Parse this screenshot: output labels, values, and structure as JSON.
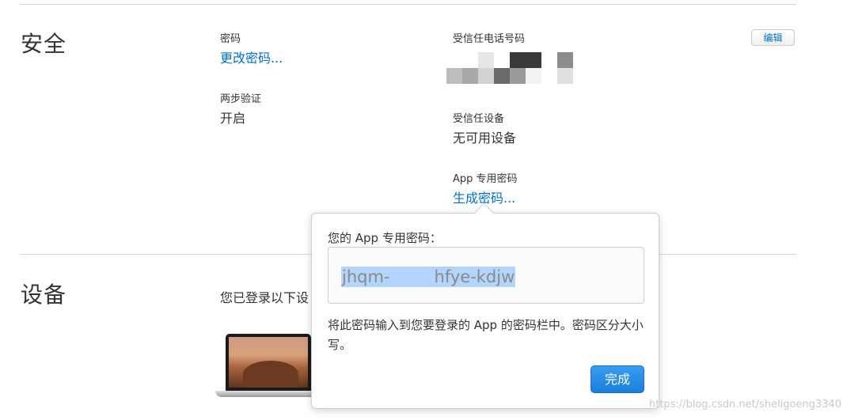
{
  "security": {
    "title": "安全",
    "password_label": "密码",
    "change_password_link": "更改密码...",
    "two_step_label": "两步验证",
    "two_step_value": "开启",
    "trusted_phone_label": "受信任电话号码",
    "trusted_device_label": "受信任设备",
    "trusted_device_value": "无可用设备",
    "app_password_label": "App 专用密码",
    "generate_link": "生成密码...",
    "edit_button": "编辑"
  },
  "popover": {
    "title": "您的 App 专用密码：",
    "password_part1": "jhqm-",
    "password_part2": "hfye-kdjw",
    "description": "将此密码输入到您要登录的 App 的密码栏中。密码区分大小写。",
    "done_button": "完成"
  },
  "devices": {
    "title": "设备",
    "subtitle": "您已登录以下设"
  },
  "watermark": "https://blog.csdn.net/sheligoeng3340",
  "colors": {
    "link": "#0070c9",
    "button_blue": "#1a7fdc",
    "selection": "#b3d4fc"
  },
  "icons": {
    "laptop": "macbook-laptop-icon"
  }
}
